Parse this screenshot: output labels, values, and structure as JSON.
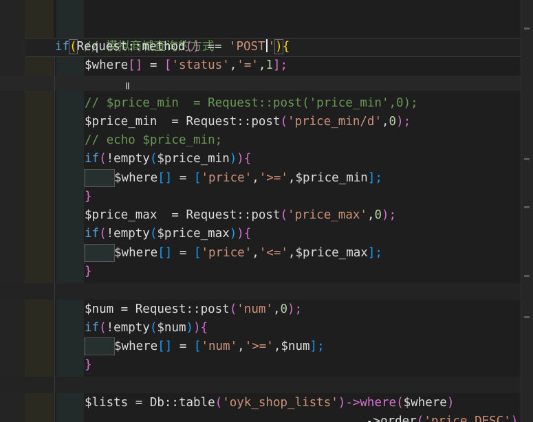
{
  "editor": {
    "lines": {
      "l1": "// 模拟商城查询的方式",
      "l2_kw": "if",
      "l2_open": "(",
      "l2_a": "Request::method",
      "l2_call": "()",
      "l2_b": " == ",
      "l2_str_a": "'POST",
      "l2_str_b": "'",
      "l2_close": ")",
      "l2_brace": "{",
      "l3_a": "$where",
      "l3_b": "[]",
      "l3_c": " = ",
      "l3_d": "[",
      "l3_e": "'status'",
      "l3_f": ",",
      "l3_g": "'='",
      "l3_h": ",",
      "l3_i": "1",
      "l3_j": "];",
      "l5": "// $price_min  = Request::post('price_min',0);",
      "l6_a": "$price_min  = Request::post",
      "l6_b": "(",
      "l6_c": "'price_min/d'",
      "l6_d": ",",
      "l6_e": "0",
      "l6_f": ");",
      "l7": "// echo $price_min;",
      "l8_kw": "if",
      "l8_a": "(",
      "l8_b": "!empty",
      "l8_c": "(",
      "l8_d": "$price_min",
      "l8_e": ")",
      "l8_f": ")",
      "l8_g": "{",
      "l9_a": "$where",
      "l9_b": "[]",
      "l9_c": " = ",
      "l9_d": "[",
      "l9_e": "'price'",
      "l9_f": ",",
      "l9_g": "'>='",
      "l9_h": ",$price_min",
      "l9_i": "];",
      "l10": "}",
      "l11_a": "$price_max  = Request::post",
      "l11_b": "(",
      "l11_c": "'price_max'",
      "l11_d": ",",
      "l11_e": "0",
      "l11_f": ");",
      "l12_kw": "if",
      "l12_a": "(",
      "l12_b": "!empty",
      "l12_c": "(",
      "l12_d": "$price_max",
      "l12_e": ")",
      "l12_f": ")",
      "l12_g": "{",
      "l13_a": "$where",
      "l13_b": "[]",
      "l13_c": " = ",
      "l13_d": "[",
      "l13_e": "'price'",
      "l13_f": ",",
      "l13_g": "'<='",
      "l13_h": ",$price_max",
      "l13_i": "];",
      "l14": "}",
      "l16_a": "$num = Request::post",
      "l16_b": "(",
      "l16_c": "'num'",
      "l16_d": ",",
      "l16_e": "0",
      "l16_f": ");",
      "l17_kw": "if",
      "l17_a": "(",
      "l17_b": "!empty",
      "l17_c": "(",
      "l17_d": "$num",
      "l17_e": ")",
      "l17_f": ")",
      "l17_g": "{",
      "l18_a": "$where",
      "l18_b": "[]",
      "l18_c": " = ",
      "l18_d": "[",
      "l18_e": "'num'",
      "l18_f": ",",
      "l18_g": "'>='",
      "l18_h": ",$num",
      "l18_i": "];",
      "l19": "}",
      "l21_a": "$lists = Db::table",
      "l21_b": "(",
      "l21_c": "'oyk_shop_lists'",
      "l21_d": ")->where",
      "l21_e": "(",
      "l21_f": "$where",
      "l21_g": ")",
      "l22_a": "->order",
      "l22_b": "(",
      "l22_c": "'price DESC'",
      "l22_d": ")"
    }
  },
  "colors": {
    "background": "#1e1e1e",
    "comment": "#6a9955",
    "keyword": "#569cd6",
    "string": "#ce9178",
    "number": "#b5cea8",
    "bracket_gold": "#ffd700",
    "bracket_purple": "#da70d6",
    "bracket_blue": "#179fff"
  }
}
